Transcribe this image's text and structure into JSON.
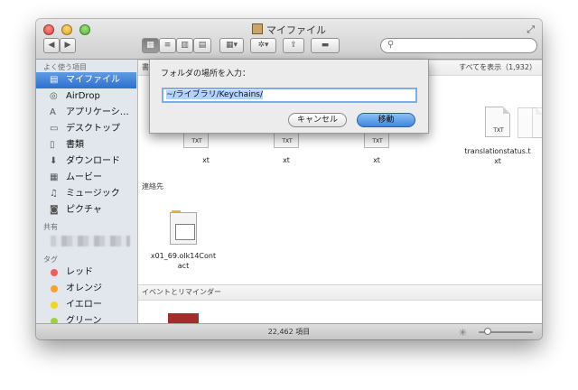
{
  "window": {
    "title": "マイファイル"
  },
  "sidebar": {
    "favorites_header": "よく使う項目",
    "favorites": [
      {
        "label": "マイファイル",
        "icon": "all-my-files-icon",
        "selected": true
      },
      {
        "label": "AirDrop",
        "icon": "airdrop-icon"
      },
      {
        "label": "アプリケーシ…",
        "icon": "applications-icon"
      },
      {
        "label": "デスクトップ",
        "icon": "desktop-icon"
      },
      {
        "label": "書類",
        "icon": "documents-icon"
      },
      {
        "label": "ダウンロード",
        "icon": "downloads-icon"
      },
      {
        "label": "ムービー",
        "icon": "movies-icon"
      },
      {
        "label": "ミュージック",
        "icon": "music-icon"
      },
      {
        "label": "ピクチャ",
        "icon": "pictures-icon"
      }
    ],
    "shared_header": "共有",
    "tags_header": "タグ",
    "tags": [
      {
        "label": "レッド",
        "color": "#f35a58"
      },
      {
        "label": "オレンジ",
        "color": "#f8a229"
      },
      {
        "label": "イエロー",
        "color": "#f4d51f"
      },
      {
        "label": "グリーン",
        "color": "#9ad33d"
      }
    ]
  },
  "content": {
    "sections": {
      "documents": "書",
      "contacts": "連絡先",
      "events": "イベントとリマインダー"
    },
    "show_all": "すべてを表示（1,932）",
    "doc_items": [
      {
        "name_line1": "",
        "name_line2": "xt",
        "type": "TXT"
      },
      {
        "name_line1": "",
        "name_line2": "xt",
        "type": "TXT"
      },
      {
        "name_line1": "",
        "name_line2": "xt",
        "type": "TXT"
      },
      {
        "name_line1": "translationstatus.t",
        "name_line2": "xt",
        "type": "TXT"
      }
    ],
    "contact_item": {
      "name_line1": "x01_69.olk14Cont",
      "name_line2": "act"
    }
  },
  "status": {
    "item_count": "22,462 項目"
  },
  "dialog": {
    "prompt": "フォルダの場所を入力：",
    "path_value": "~/ライブラリ/Keychains/",
    "cancel_label": "キャンセル",
    "go_label": "移動"
  },
  "colors": {
    "selection": "#2f6fcf",
    "sidebar_bg": "#e2e7ed"
  }
}
